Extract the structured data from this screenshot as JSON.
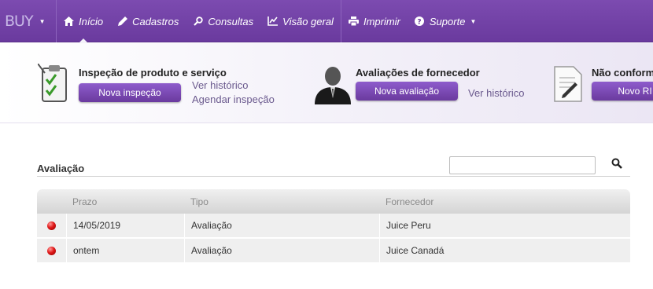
{
  "brand": {
    "text": "BUY"
  },
  "nav": {
    "items": [
      {
        "id": "inicio",
        "label": "Início",
        "icon": "home-icon"
      },
      {
        "id": "cadastros",
        "label": "Cadastros",
        "icon": "pencil-icon"
      },
      {
        "id": "consultas",
        "label": "Consultas",
        "icon": "search-icon"
      },
      {
        "id": "visao",
        "label": "Visão geral",
        "icon": "chart-icon"
      },
      {
        "id": "imprimir",
        "label": "Imprimir",
        "icon": "printer-icon"
      },
      {
        "id": "suporte",
        "label": "Suporte",
        "icon": "help-icon"
      }
    ],
    "active": "inicio"
  },
  "quick": {
    "inspecao": {
      "title": "Inspeção de produto e serviço",
      "button": "Nova inspeção",
      "links": [
        "Ver histórico",
        "Agendar inspeção"
      ],
      "icon": "clipboard-check-icon"
    },
    "avaliacoes": {
      "title": "Avaliações de fornecedor",
      "button": "Nova avaliação",
      "links": [
        "Ver histórico"
      ],
      "icon": "user-bust-icon"
    },
    "naoconf": {
      "title": "Não conform",
      "button": "Novo RI",
      "icon": "document-edit-icon"
    }
  },
  "section": {
    "title": "Avaliação",
    "search_placeholder": ""
  },
  "table": {
    "columns": [
      "",
      "Prazo",
      "Tipo",
      "Fornecedor"
    ],
    "rows": [
      {
        "status": "overdue",
        "prazo": "14/05/2019",
        "tipo": "Avaliação",
        "fornecedor": "Juice Peru"
      },
      {
        "status": "overdue",
        "prazo": "ontem",
        "tipo": "Avaliação",
        "fornecedor": "Juice Canadá"
      }
    ]
  },
  "colors": {
    "brand_purple": "#6a3a9e",
    "status_red": "#e01818"
  }
}
